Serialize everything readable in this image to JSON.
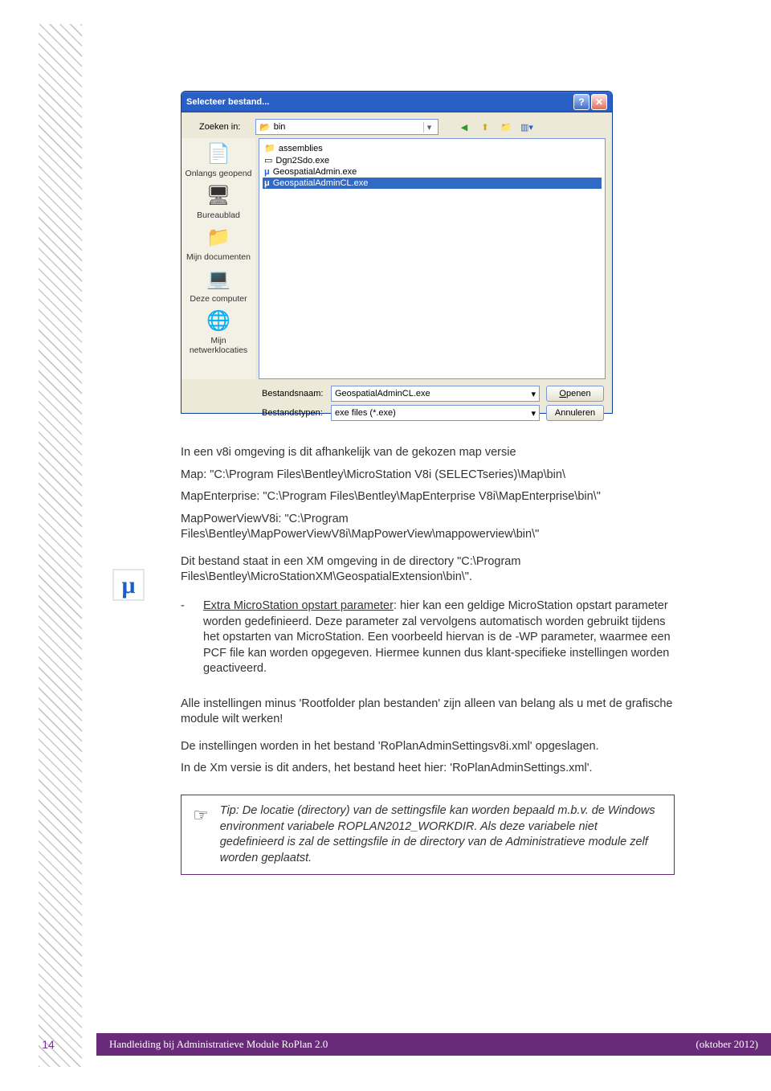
{
  "dialog": {
    "title": "Selecteer bestand...",
    "zoeken_label": "Zoeken in:",
    "zoeken_value": "bin",
    "places": [
      {
        "label": "Onlangs geopend",
        "glyph": "📄"
      },
      {
        "label": "Bureaublad",
        "glyph": "🖥"
      },
      {
        "label": "Mijn documenten",
        "glyph": "📁"
      },
      {
        "label": "Deze computer",
        "glyph": "💻"
      },
      {
        "label": "Mijn netwerklocaties",
        "glyph": "🌐"
      }
    ],
    "files": [
      {
        "name": "assemblies",
        "icon": "📁",
        "sel": false
      },
      {
        "name": "Dgn2Sdo.exe",
        "icon": "▭",
        "sel": false
      },
      {
        "name": "GeospatialAdmin.exe",
        "icon": "μ",
        "sel": false
      },
      {
        "name": "GeospatialAdminCL.exe",
        "icon": "μ",
        "sel": true
      }
    ],
    "fn_label": "Bestandsnaam:",
    "fn_value": "GeospatialAdminCL.exe",
    "ft_label": "Bestandstypen:",
    "ft_value": "exe files (*.exe)",
    "open": "Openen",
    "cancel": "Annuleren"
  },
  "body": {
    "p1": "In een v8i omgeving is dit afhankelijk van de gekozen map versie",
    "p2a": "Map: \"C:\\Program Files\\Bentley\\MicroStation V8i (SELECTseries)\\Map\\bin\\",
    "p2b": "MapEnterprise: \"C:\\Program Files\\Bentley\\MapEnterprise V8i\\MapEnterprise\\bin\\\"",
    "p2c": "MapPowerViewV8i: \"C:\\Program Files\\Bentley\\MapPowerViewV8i\\MapPowerView\\mappowerview\\bin\\\"",
    "p3": "Dit bestand staat in een XM omgeving in de directory \"C:\\Program Files\\Bentley\\MicroStationXM\\GeospatialExtension\\bin\\\".",
    "bullet_label": "Extra MicroStation opstart parameter",
    "bullet_text": ": hier kan een geldige MicroStation opstart parameter worden gedefinieerd. Deze parameter zal vervolgens automatisch worden gebruikt tijdens het opstarten van MicroStation. Een voorbeeld hiervan is de -WP parameter, waarmee een PCF file kan worden opgegeven. Hiermee kunnen dus klant-specifieke instellingen worden geactiveerd.",
    "p4": "Alle instellingen minus 'Rootfolder plan bestanden' zijn alleen van belang als u met de grafische module wilt werken!",
    "p5": "De instellingen worden in het bestand 'RoPlanAdminSettingsv8i.xml' opgeslagen.",
    "p6": "In de Xm versie is dit anders, het bestand heet hier: 'RoPlanAdminSettings.xml'.",
    "tip": "Tip: De locatie (directory) van de settingsfile kan worden bepaald m.b.v. de Windows environment variabele ROPLAN2012_WORKDIR. Als deze variabele niet gedefinieerd is zal de settingsfile in de directory van de Administratieve module zelf worden geplaatst."
  },
  "footer": {
    "page": "14",
    "title": "Handleiding bij Administratieve Module RoPlan 2.0",
    "date": "(oktober 2012)"
  }
}
